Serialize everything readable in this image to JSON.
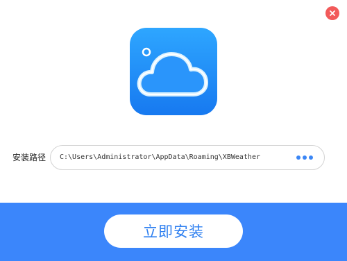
{
  "window": {
    "close_icon": "close-icon"
  },
  "app": {
    "icon": "weather-cloud-icon",
    "icon_color": "#1e8ef8"
  },
  "install_path": {
    "label": "安装路径",
    "value": "C:\\Users\\Administrator\\AppData\\Roaming\\XBWeather",
    "browse_icon": "more-dots-icon"
  },
  "footer": {
    "install_button_label": "立即安装",
    "background_color": "#3b86fb",
    "accent_color": "#2f80f0"
  }
}
